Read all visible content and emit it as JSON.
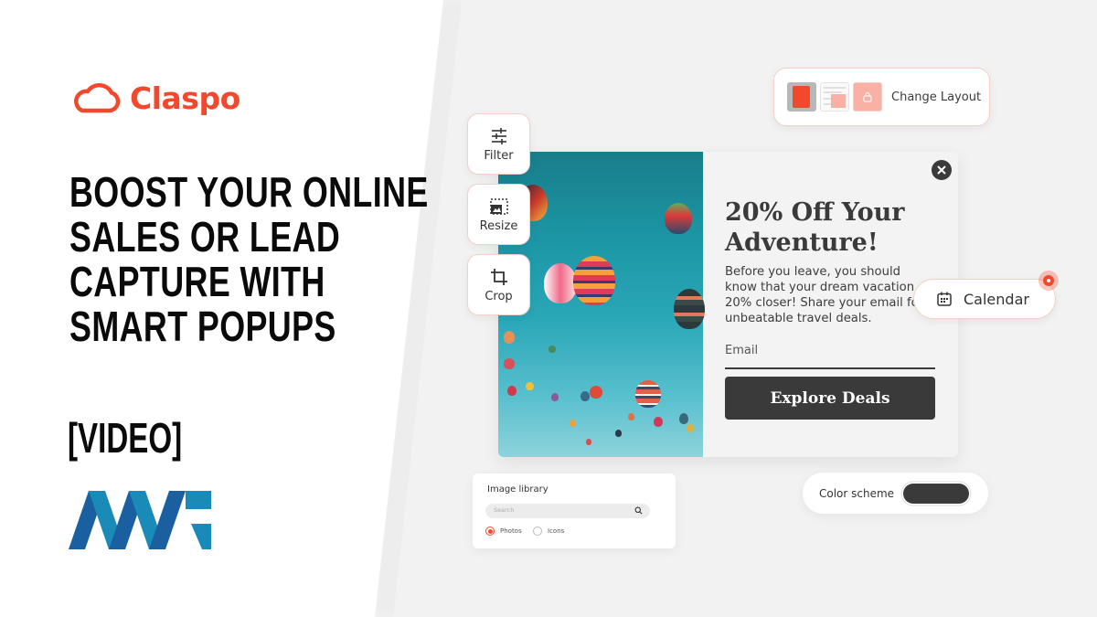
{
  "brand": {
    "name": "Claspo",
    "logo_icon": "cloud-icon",
    "color": "#f2492c"
  },
  "headline": {
    "lines": [
      "BOOST YOUR ONLINE",
      "SALES OR LEAD",
      "CAPTURE WITH",
      "SMART POPUPS"
    ]
  },
  "video_tag": "[VIDEO]",
  "publisher_logo": "mt-logo",
  "layout_widget": {
    "label": "Change Layout",
    "options": [
      "layout-popup-full",
      "layout-popup-inline",
      "layout-locked"
    ],
    "selected": 0
  },
  "tools": [
    {
      "label": "Filter",
      "icon": "sliders-icon"
    },
    {
      "label": "Resize",
      "icon": "resize-image-icon"
    },
    {
      "label": "Crop",
      "icon": "crop-icon"
    }
  ],
  "popup": {
    "title": "20% Off Your Adventure!",
    "body": "Before you leave, you should know that your dream vacation 20% closer! Share your email fo unbeatable travel deals.",
    "email_placeholder": "Email",
    "cta": "Explore Deals",
    "image_alt": "hot-air-balloons-image"
  },
  "calendar": {
    "label": "Calendar",
    "has_notification": true
  },
  "image_library": {
    "title": "Image library",
    "search_placeholder": "Search",
    "options": [
      {
        "label": "Photos",
        "selected": true
      },
      {
        "label": "Icons",
        "selected": false
      }
    ]
  },
  "color_scheme": {
    "label": "Color scheme",
    "value": "#3a3a3a"
  }
}
